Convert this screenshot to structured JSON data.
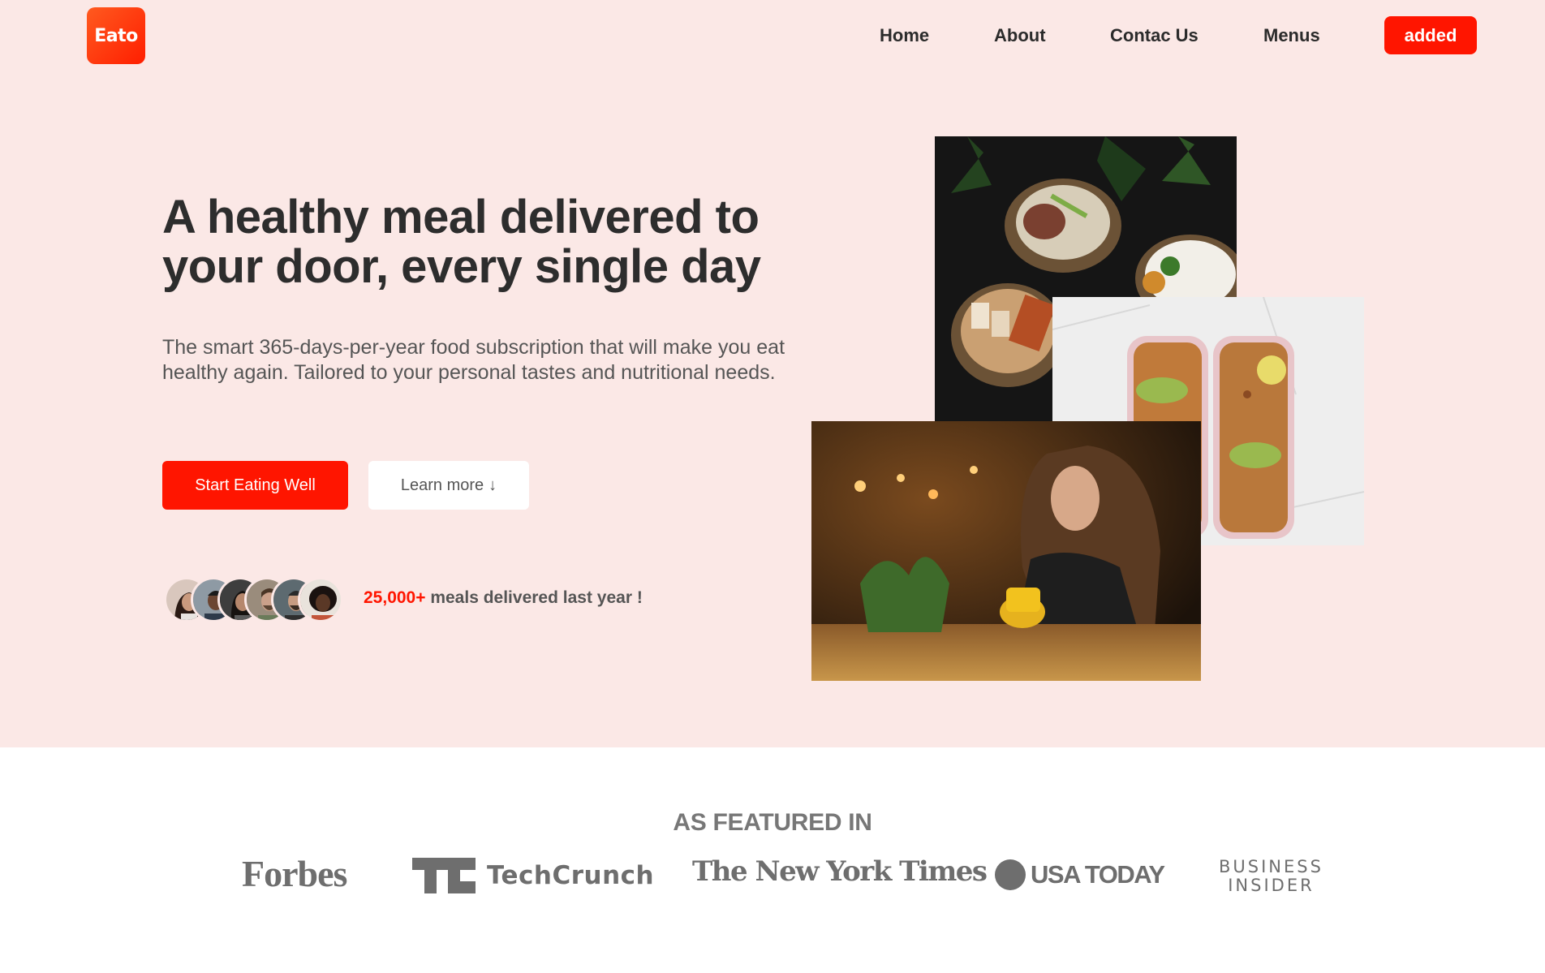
{
  "brand": {
    "logo_text": "Eato",
    "accent": "#ff1500",
    "hero_bg": "#fbe8e6"
  },
  "nav": {
    "items": [
      {
        "label": "Home"
      },
      {
        "label": "About"
      },
      {
        "label": "Contac Us"
      },
      {
        "label": "Menus"
      }
    ],
    "cta_label": "added"
  },
  "hero": {
    "headline": "A healthy meal delivered to your door, every single day",
    "subtext": "The smart 365-days-per-year food subscription that will make you eat healthy again. Tailored to your personal tastes and nutritional needs.",
    "primary_button": "Start Eating Well",
    "secondary_button": "Learn more",
    "secondary_arrow": "↓",
    "stat_number": "25,000+",
    "stat_text": " meals delivered last year !"
  },
  "featured": {
    "title": "AS FEATURED IN",
    "logos": [
      "Forbes",
      "TechCrunch",
      "The New York Times",
      "USA TODAY",
      "BUSINESS",
      "INSIDER"
    ]
  }
}
